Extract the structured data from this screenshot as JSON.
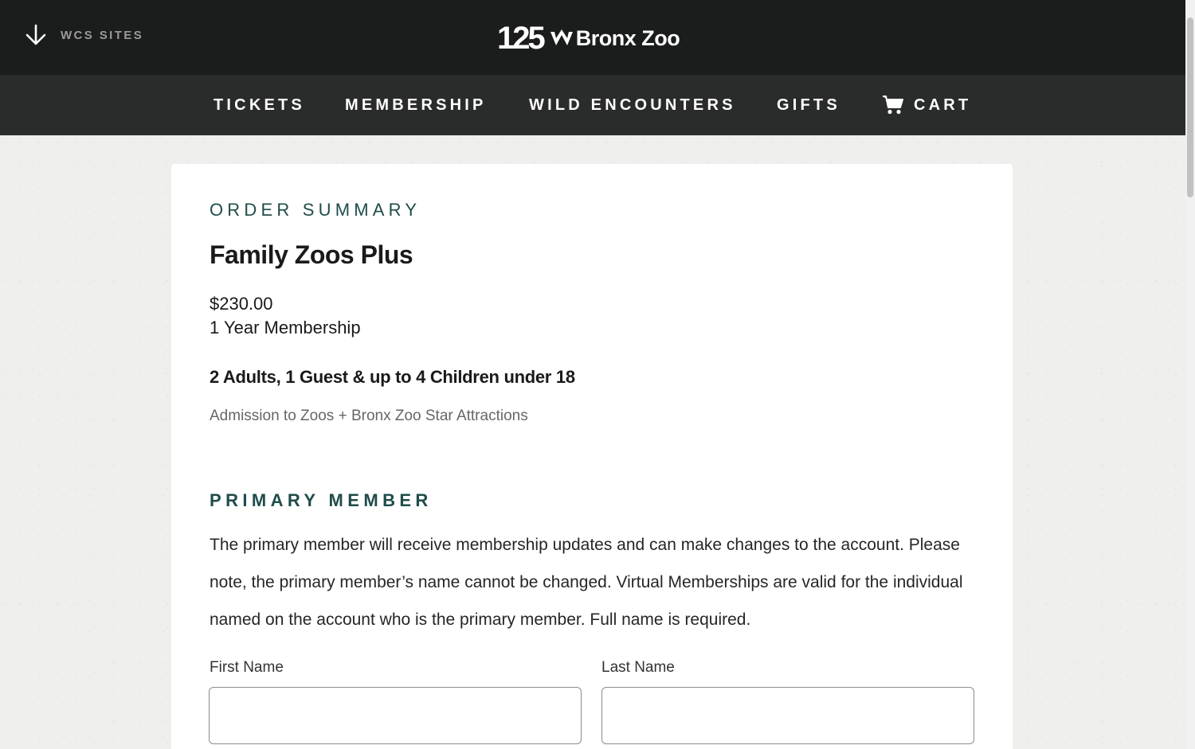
{
  "header": {
    "wcs_sites_label": "WCS SITES",
    "logo_number": "125",
    "logo_name": "Bronx Zoo"
  },
  "nav": {
    "items": [
      {
        "label": "TICKETS"
      },
      {
        "label": "MEMBERSHIP"
      },
      {
        "label": "WILD ENCOUNTERS"
      },
      {
        "label": "GIFTS"
      },
      {
        "label": "CART"
      }
    ]
  },
  "order": {
    "heading": "ORDER SUMMARY",
    "product_title": "Family Zoos Plus",
    "price": "$230.00",
    "term": "1 Year Membership",
    "guests": "2 Adults, 1 Guest & up to 4 Children under 18",
    "admission": "Admission to Zoos + Bronx Zoo Star Attractions"
  },
  "primary_member": {
    "heading": "PRIMARY MEMBER",
    "description": "The primary member will receive membership updates and can make changes to the account. Please note, the primary member’s name cannot be changed. Virtual Memberships are valid for the individual named on the account who is the primary member. Full name is required.",
    "first_name_label": "First Name",
    "first_name_value": "",
    "last_name_label": "Last Name",
    "last_name_value": ""
  },
  "icons": {
    "wcs_sites": "arrow-down-icon",
    "logo_mark": "wcs-logo-icon",
    "cart": "cart-icon"
  },
  "colors": {
    "header_bg": "#1b1c1c",
    "nav_bg": "#2a2b2b",
    "accent_teal": "#1f4c4a",
    "page_bg": "#efefee"
  }
}
